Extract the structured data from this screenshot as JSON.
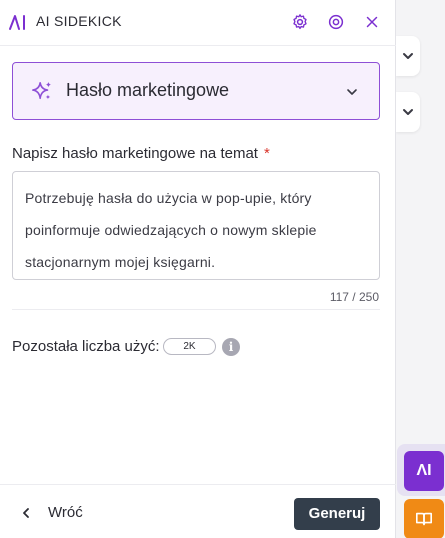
{
  "header": {
    "title": "AI SIDEKICK",
    "logo_icon": "ai-logo-icon",
    "settings_icon": "gear-icon",
    "target_icon": "target-icon",
    "close_icon": "close-icon",
    "accent_color": "#7b2fd0"
  },
  "selector": {
    "icon": "sparkle-icon",
    "selected_value": "Hasło marketingowe",
    "chevron_icon": "chevron-down-icon"
  },
  "prompt_field": {
    "label": "Napisz hasło marketingowe na temat",
    "required_mark": "*",
    "value": "Potrzebuję hasła do użycia w pop-upie, który poinformuje odwiedzających o nowym sklepie stacjonarnym mojej księgarni.",
    "char_counter": "117 / 250"
  },
  "usage": {
    "label": "Pozostała liczba użyć:",
    "value": "2K",
    "info_icon_text": "i"
  },
  "footer": {
    "back_label": "Wróć",
    "generate_label": "Generuj"
  },
  "side_dock": {
    "ai_button_label": "ΛI",
    "ai_button_color": "#7b2fd0",
    "book_button_icon": "book-icon",
    "book_button_color": "#f08a15"
  }
}
